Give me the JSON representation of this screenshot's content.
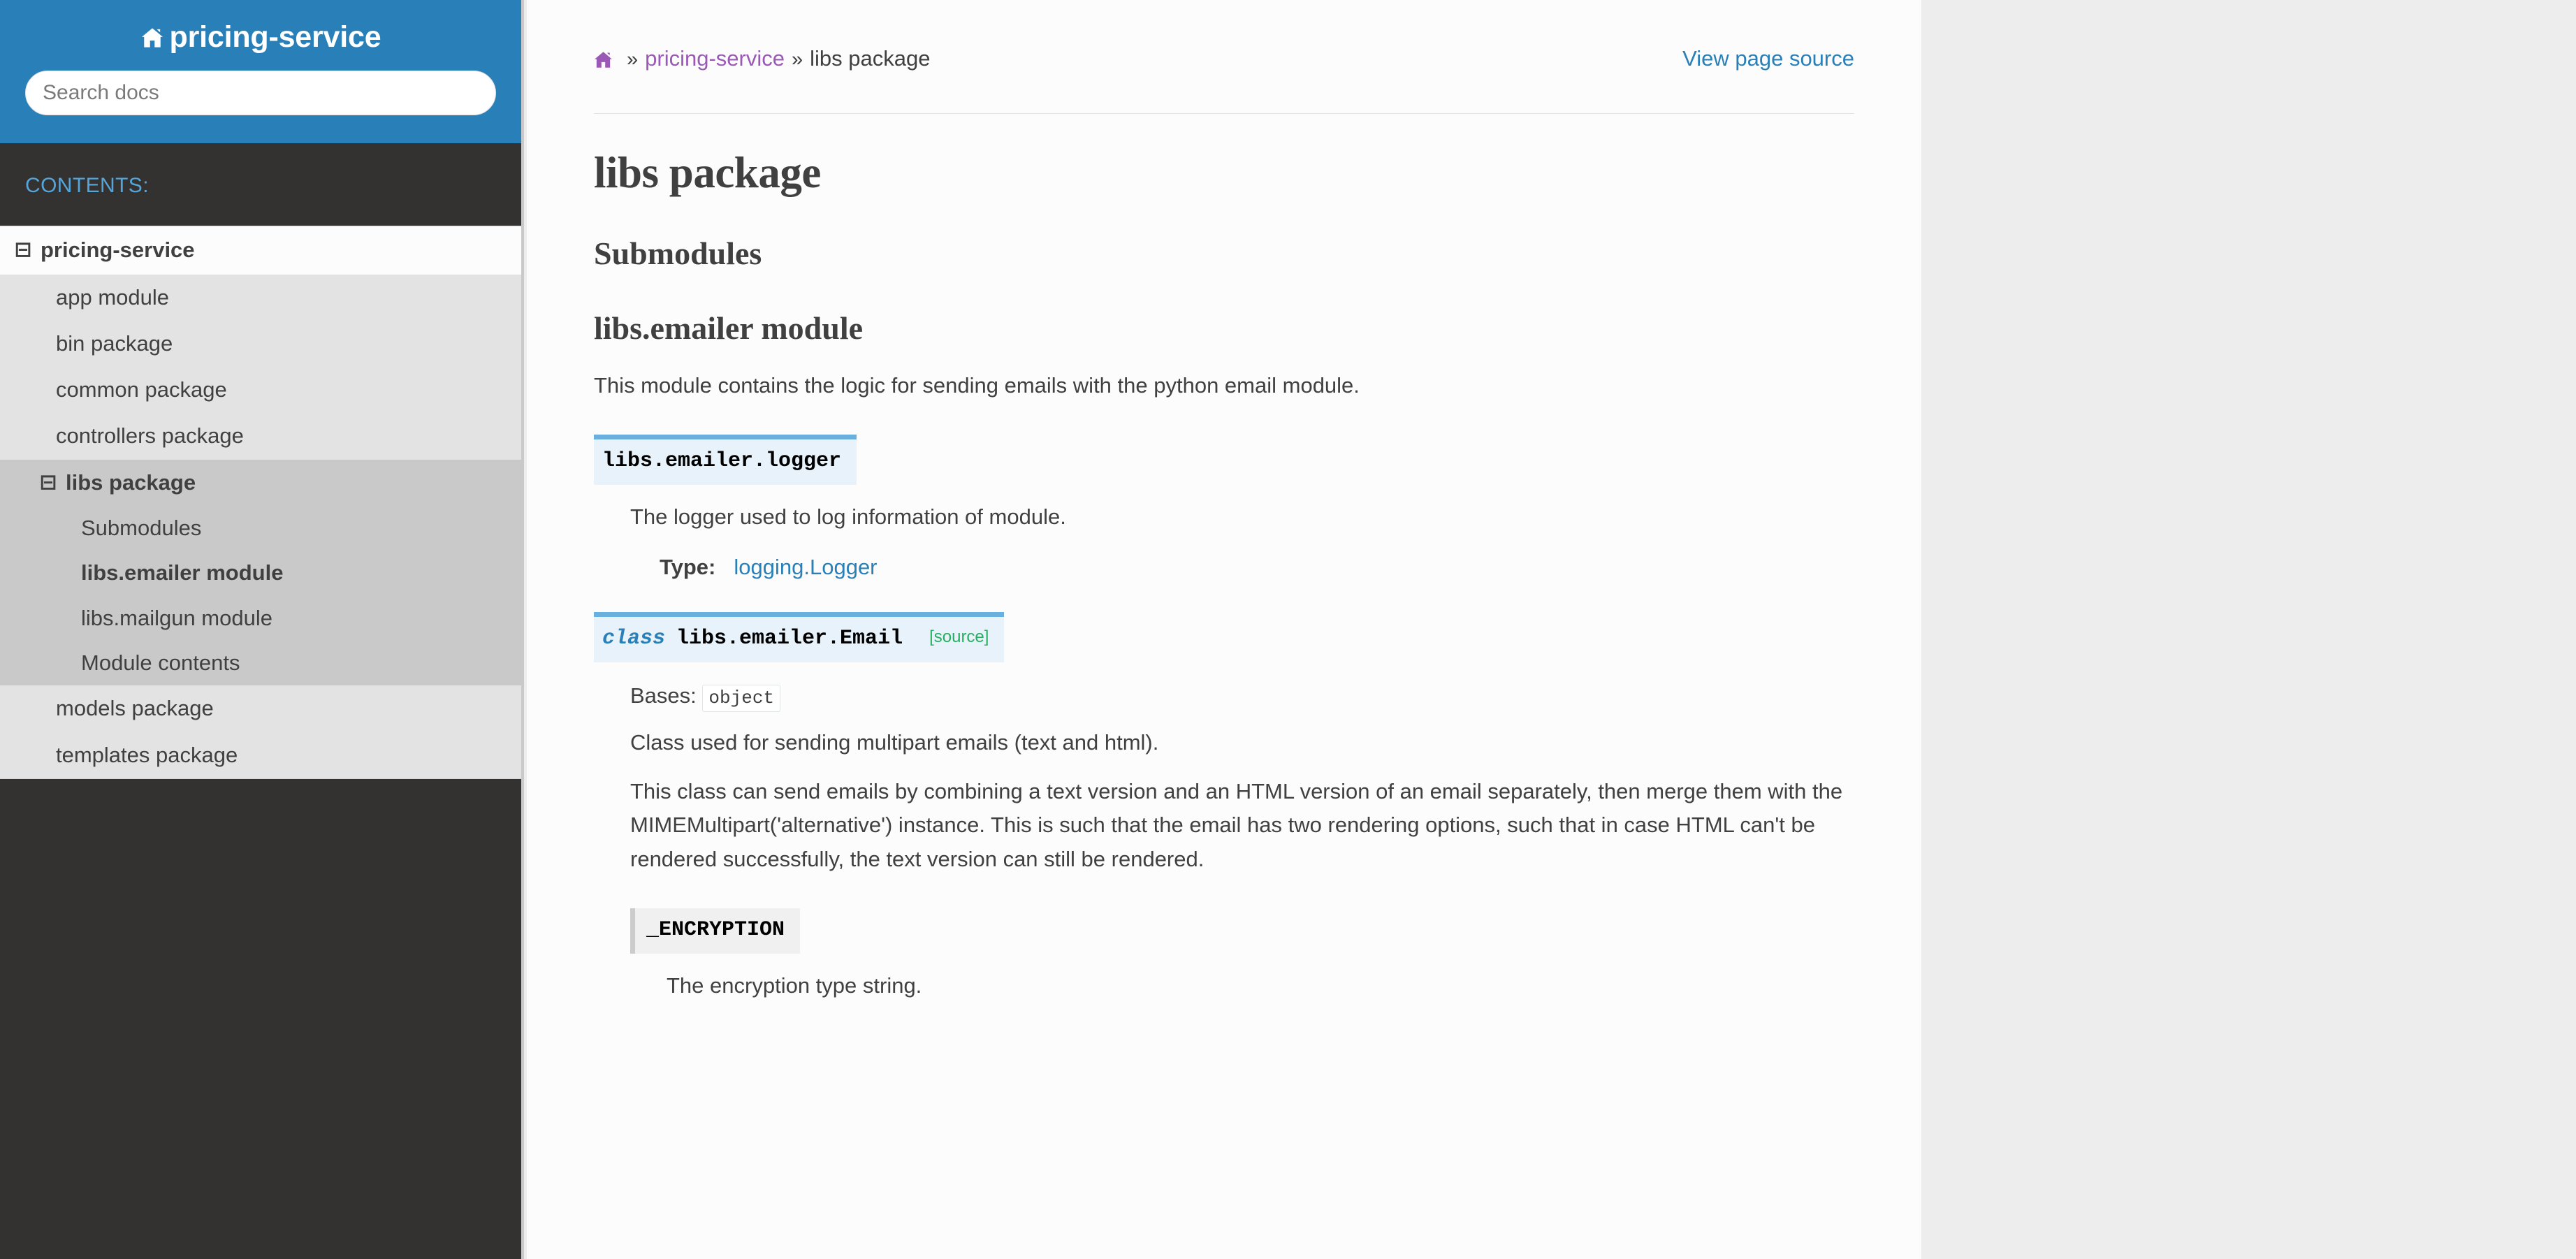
{
  "sidebar": {
    "brand": "pricing-service",
    "home_icon": "home-icon",
    "search": {
      "placeholder": "Search docs",
      "value": ""
    },
    "contents_label": "CONTENTS:",
    "toggle_glyph": "⊟",
    "root": {
      "label": "pricing-service"
    },
    "items": [
      {
        "label": "app module"
      },
      {
        "label": "bin package"
      },
      {
        "label": "common package"
      },
      {
        "label": "controllers package"
      },
      {
        "label": "libs package",
        "current": true,
        "children": [
          {
            "label": "Submodules"
          },
          {
            "label": "libs.emailer module",
            "current": true
          },
          {
            "label": "libs.mailgun module"
          },
          {
            "label": "Module contents"
          }
        ]
      },
      {
        "label": "models package"
      },
      {
        "label": "templates package"
      }
    ]
  },
  "breadcrumbs": {
    "home_icon": "home-icon",
    "separator": "»",
    "parent": "pricing-service",
    "current": "libs package",
    "view_source": "View page source"
  },
  "content": {
    "h1": "libs package",
    "h2_submodules": "Submodules",
    "h2_emailer": "libs.emailer module",
    "intro": "This module contains the logic for sending emails with the python email module.",
    "logger": {
      "signature": "libs.emailer.logger",
      "description": "The logger used to log information of module.",
      "field_name": "Type:",
      "field_value": "logging.Logger"
    },
    "email_class": {
      "keyword": "class",
      "signature": "libs.emailer.Email",
      "source_label": "[source]",
      "bases_label": "Bases:",
      "bases_value": "object",
      "summary": "Class used for sending multipart emails (text and html).",
      "detail": "This class can send emails by combining a text version and an HTML version of an email separately, then merge them with the MIMEMultipart('alternative') instance. This is such that the email has two rendering options, such that in case HTML can't be rendered successfully, the text version can still be rendered."
    },
    "encryption": {
      "signature": "_ENCRYPTION",
      "description": "The encryption type string."
    }
  },
  "colors": {
    "brand_blue": "#2980b9",
    "sidebar_dark": "#343131",
    "contents_blue": "#55a5d9",
    "link_blue": "#2980b9",
    "visited_purple": "#9b59b6",
    "source_green": "#27ae60",
    "sig_bg": "#e7f2fa",
    "sig_border": "#6ab0de",
    "attr_bg": "#f0f0f0",
    "page_bg": "#ededed"
  }
}
